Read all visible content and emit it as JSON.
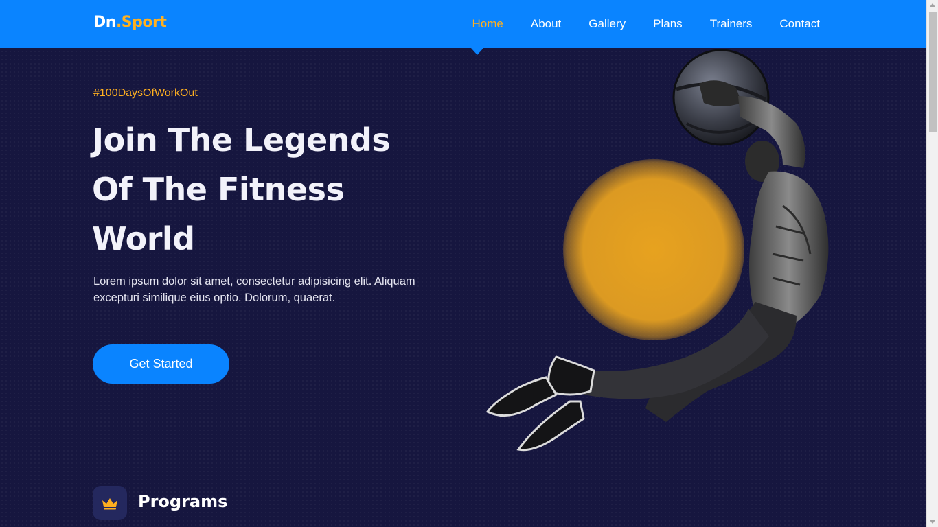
{
  "brand": {
    "name_part1": "Dn",
    "name_part2": ".Sport"
  },
  "nav": {
    "items": [
      {
        "label": "Home",
        "active": true
      },
      {
        "label": "About"
      },
      {
        "label": "Gallery"
      },
      {
        "label": "Plans"
      },
      {
        "label": "Trainers"
      },
      {
        "label": "Contact"
      }
    ]
  },
  "hero": {
    "hashtag": "#100DaysOfWorkOut",
    "headline_line1": "Join The Legends",
    "headline_line2": "Of The Fitness",
    "headline_line3": "World",
    "description": "Lorem ipsum dolor sit amet, consectetur adipisicing elit. Aliquam excepturi similique eius optio. Dolorum, quaerat.",
    "cta_label": "Get Started",
    "image_icon": "athlete-jumping-with-medicine-ball"
  },
  "programs": {
    "title": "Programs",
    "icon": "crown-icon"
  },
  "colors": {
    "primary": "#0a84ff",
    "accent": "#ffb020",
    "background": "#16163f",
    "text": "#f2f2fa"
  }
}
